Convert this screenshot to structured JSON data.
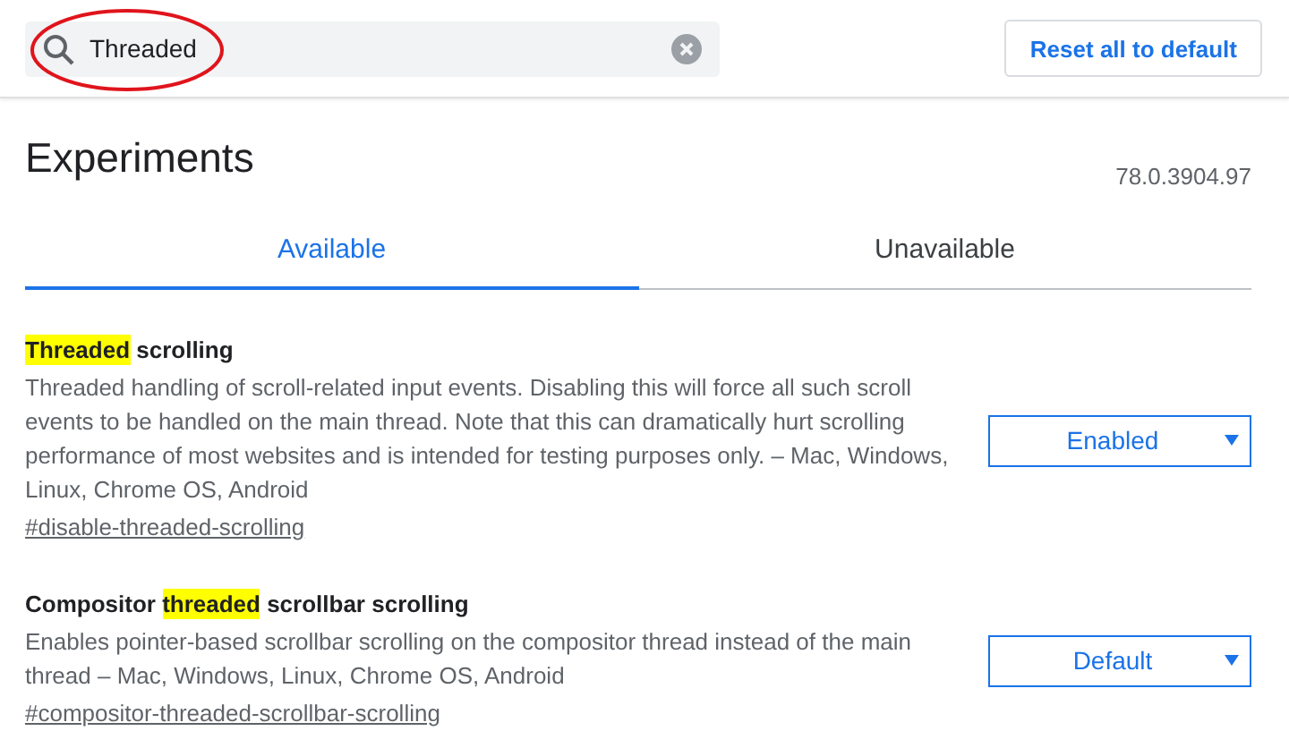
{
  "search": {
    "value": "Threaded",
    "circled": true
  },
  "reset_button": "Reset all to default",
  "title": "Experiments",
  "version": "78.0.3904.97",
  "tabs": [
    {
      "label": "Available",
      "selected": true
    },
    {
      "label": "Unavailable",
      "selected": false
    }
  ],
  "experiments": [
    {
      "title": [
        {
          "text": "Threaded",
          "highlighted": true
        },
        {
          "text": " scrolling",
          "highlighted": false
        }
      ],
      "description": "Threaded handling of scroll-related input events. Disabling this will force all such scroll events to be handled on the main thread. Note that this can dramatically hurt scrolling performance of most websites and is intended for testing purposes only. – Mac, Windows, Linux, Chrome OS, Android",
      "link": "#disable-threaded-scrolling",
      "value": "Enabled"
    },
    {
      "title": [
        {
          "text": "Compositor ",
          "highlighted": false
        },
        {
          "text": "threaded",
          "highlighted": true
        },
        {
          "text": " scrollbar scrolling",
          "highlighted": false
        }
      ],
      "description": "Enables pointer-based scrollbar scrolling on the compositor thread instead of the main thread – Mac, Windows, Linux, Chrome OS, Android",
      "link": "#compositor-threaded-scrollbar-scrolling",
      "value": "Default"
    }
  ]
}
